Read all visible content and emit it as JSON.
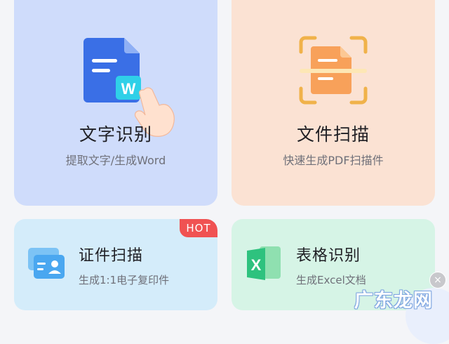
{
  "cards": {
    "ocr": {
      "title": "文字识别",
      "subtitle": "提取文字/生成Word",
      "icon": "word-document-icon",
      "overlay_icon": "hand-pointer-icon",
      "icon_letter": "W"
    },
    "scan": {
      "title": "文件扫描",
      "subtitle": "快速生成PDF扫描件",
      "icon": "document-scan-icon"
    },
    "id": {
      "title": "证件扫描",
      "subtitle": "生成1:1电子复印件",
      "icon": "id-card-icon",
      "badge": "HOT"
    },
    "table": {
      "title": "表格识别",
      "subtitle": "生成Excel文档",
      "icon": "excel-icon",
      "icon_letter": "X"
    }
  },
  "floating": {
    "close_label": "×",
    "icon": "floating-tool-icon"
  },
  "watermark": "广东龙网",
  "colors": {
    "ocr_bg": "#cfdcfb",
    "scan_bg": "#fbe2d3",
    "id_bg": "#d4ecfa",
    "table_bg": "#d6f4e6",
    "hot": "#f05252"
  }
}
